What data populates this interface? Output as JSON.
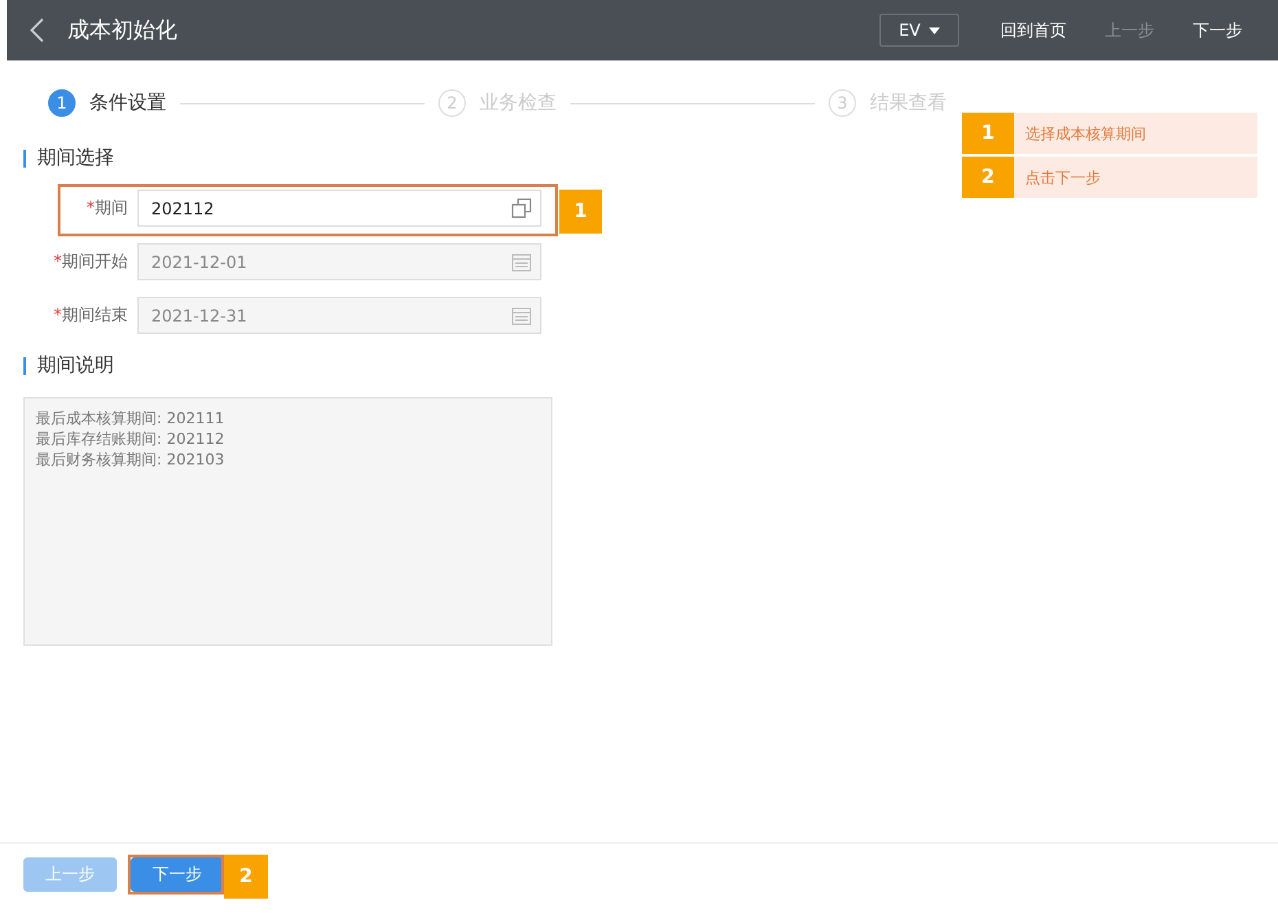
{
  "header": {
    "title": "成本初始化",
    "language": "EV",
    "actions": [
      {
        "label": "回到首页",
        "disabled": false
      },
      {
        "label": "上一步",
        "disabled": true
      },
      {
        "label": "下一步",
        "disabled": false
      }
    ]
  },
  "steps": [
    {
      "number": "1",
      "label": "条件设置",
      "selected": true
    },
    {
      "number": "2",
      "label": "业务检查",
      "selected": false
    },
    {
      "number": "3",
      "label": "结果查看",
      "selected": false
    }
  ],
  "guide": [
    {
      "number": "1",
      "text": "选择成本核算期间"
    },
    {
      "number": "2",
      "text": "点击下一步"
    }
  ],
  "period_section": {
    "title": "期间选择",
    "fields": [
      {
        "label": "期间",
        "required_mark": "*",
        "value": "202112",
        "disabled": false,
        "kind": "lookup",
        "marker": "1"
      },
      {
        "label": "期间开始",
        "required_mark": "*",
        "value": "2021-12-01",
        "disabled": true,
        "kind": "date"
      },
      {
        "label": "期间结束",
        "required_mark": "*",
        "value": "2021-12-31",
        "disabled": true,
        "kind": "date"
      }
    ]
  },
  "description_section": {
    "title": "期间说明",
    "lines": [
      "最后成本核算期间: 202111",
      "最后库存结账期间: 202112",
      "最后财务核算期间: 202103"
    ]
  },
  "footer": {
    "buttons": [
      {
        "label": "上一步",
        "disabled": true
      },
      {
        "label": "下一步",
        "disabled": false,
        "marker": "2"
      }
    ]
  }
}
